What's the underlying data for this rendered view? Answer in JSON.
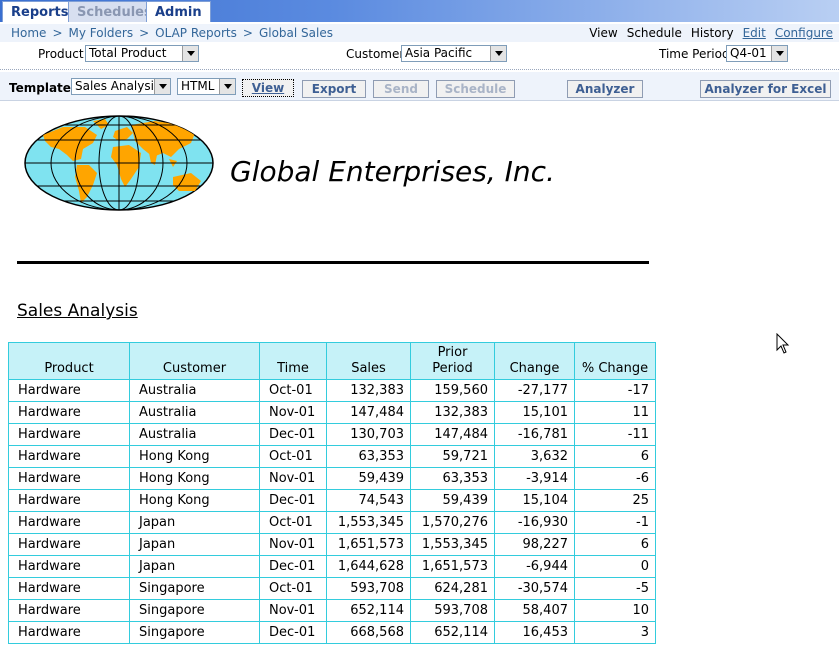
{
  "tabs": [
    {
      "label": "Reports",
      "state": "active"
    },
    {
      "label": "Schedules",
      "state": "inactive"
    },
    {
      "label": "Admin",
      "state": "normal"
    }
  ],
  "breadcrumbs": [
    "Home",
    "My Folders",
    "OLAP Reports",
    "Global Sales"
  ],
  "top_links": {
    "view": "View",
    "schedule": "Schedule",
    "history": "History",
    "edit": "Edit",
    "configure": "Configure"
  },
  "params": {
    "product": {
      "label": "Product",
      "value": "Total Product"
    },
    "customer": {
      "label": "Customer",
      "value": "Asia Pacific"
    },
    "time_period": {
      "label": "Time Period",
      "value": "Q4-01"
    }
  },
  "toolbar": {
    "template_label": "Template",
    "template_value": "Sales Analysis",
    "format_value": "HTML",
    "view": "View",
    "export": "Export",
    "send": "Send",
    "schedule": "Schedule",
    "analyzer": "Analyzer",
    "analyzer_excel": "Analyzer for Excel"
  },
  "report": {
    "company": "Global Enterprises, Inc.",
    "section_title": "Sales Analysis",
    "columns": [
      "Product",
      "Customer",
      "Time",
      "Sales",
      "Prior Period",
      "Change",
      "% Change"
    ],
    "rows": [
      [
        "Hardware",
        "Australia",
        "Oct-01",
        "132,383",
        "159,560",
        "-27,177",
        "-17"
      ],
      [
        "Hardware",
        "Australia",
        "Nov-01",
        "147,484",
        "132,383",
        "15,101",
        "11"
      ],
      [
        "Hardware",
        "Australia",
        "Dec-01",
        "130,703",
        "147,484",
        "-16,781",
        "-11"
      ],
      [
        "Hardware",
        "Hong Kong",
        "Oct-01",
        "63,353",
        "59,721",
        "3,632",
        "6"
      ],
      [
        "Hardware",
        "Hong Kong",
        "Nov-01",
        "59,439",
        "63,353",
        "-3,914",
        "-6"
      ],
      [
        "Hardware",
        "Hong Kong",
        "Dec-01",
        "74,543",
        "59,439",
        "15,104",
        "25"
      ],
      [
        "Hardware",
        "Japan",
        "Oct-01",
        "1,553,345",
        "1,570,276",
        "-16,930",
        "-1"
      ],
      [
        "Hardware",
        "Japan",
        "Nov-01",
        "1,651,573",
        "1,553,345",
        "98,227",
        "6"
      ],
      [
        "Hardware",
        "Japan",
        "Dec-01",
        "1,644,628",
        "1,651,573",
        "-6,944",
        "0"
      ],
      [
        "Hardware",
        "Singapore",
        "Oct-01",
        "593,708",
        "624,281",
        "-30,574",
        "-5"
      ],
      [
        "Hardware",
        "Singapore",
        "Nov-01",
        "652,114",
        "593,708",
        "58,407",
        "10"
      ],
      [
        "Hardware",
        "Singapore",
        "Dec-01",
        "668,568",
        "652,114",
        "16,453",
        "3"
      ]
    ]
  },
  "colors": {
    "header_bg": "#c6f2f8",
    "grid": "#33ccdd",
    "globe_ocean": "#7fe3f0",
    "globe_land": "#ffa500",
    "link": "#336699"
  }
}
